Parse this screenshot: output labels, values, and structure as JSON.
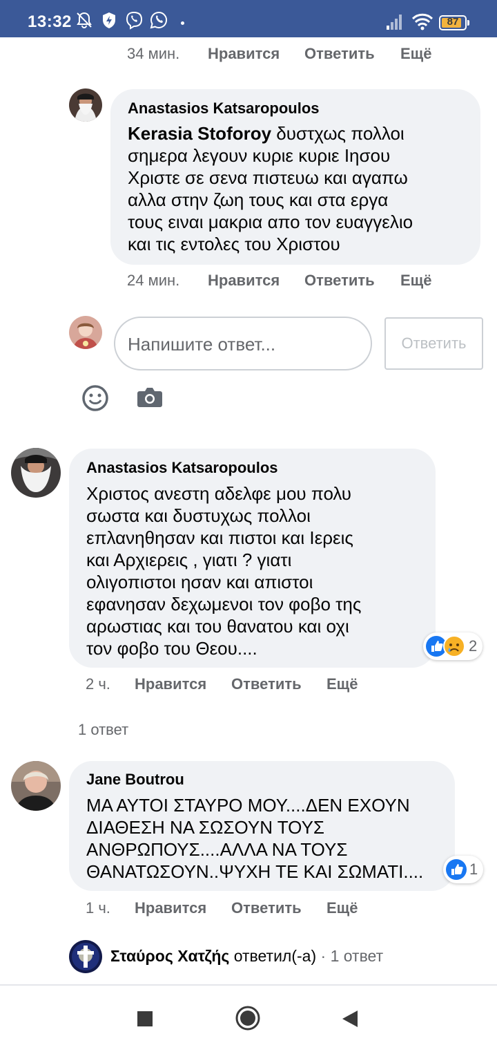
{
  "status_bar": {
    "time": "13:32",
    "battery": "87",
    "battery_level": 0.87,
    "icons": [
      "bell-off-icon",
      "shield-icon",
      "viber-icon",
      "whatsapp-icon",
      "signal-icon",
      "wifi-icon",
      "battery-icon"
    ]
  },
  "top_actions": {
    "time": "34 мин.",
    "like": "Нравится",
    "reply": "Ответить",
    "more": "Ещё"
  },
  "reply_comment": {
    "author": "Anastasios Katsaropoulos",
    "mention": "Kerasia Stoforoy",
    "lines": [
      " δυστχως πολλοι",
      "σημερα λεγουν κυριε κυριε Ιησου",
      "Χριστε σε σενα πιστευω και αγαπω",
      "αλλα στην ζωη τους και στα εργα",
      "τους ειναι μακρια απο τον ευαγγελιο",
      "και τις εντολες του Χριστου"
    ],
    "actions": {
      "time": "24 мин.",
      "like": "Нравится",
      "reply": "Ответить",
      "more": "Ещё"
    }
  },
  "composer": {
    "placeholder": "Напишите ответ...",
    "button": "Ответить",
    "icons": [
      "emoji-icon",
      "camera-icon"
    ]
  },
  "comment_1": {
    "author": "Anastasios Katsaropoulos",
    "lines": [
      "Χριστος ανεστη αδελφε μου πολυ",
      "σωστα και δυστυχως πολλοι",
      "επλανηθησαν και πιστοι και Ιερεις",
      "και Αρχιερεις , γιατι ? γιατι",
      "ολιγοπιστοι ησαν και απιστοι",
      "εφανησαν δεχωμενοι τον φοβο της",
      "αρωστιας και του θανατου και οχι",
      "τον φοβο του Θεου...."
    ],
    "reactions": {
      "count": "2",
      "icons": [
        "like-reaction-icon",
        "sad-reaction-icon"
      ]
    },
    "actions": {
      "time": "2 ч.",
      "like": "Нравится",
      "reply": "Ответить",
      "more": "Ещё"
    },
    "replies_link": "1 ответ"
  },
  "comment_2": {
    "author": "Jane Boutrou",
    "lines": [
      "ΜΑ ΑΥΤΟΙ ΣΤΑΥΡΟ ΜΟΥ....ΔΕΝ ΕΧΟΥΝ",
      "ΔΙΑΘΕΣΗ ΝΑ ΣΩΣΟΥΝ ΤΟΥΣ",
      "ΑΝΘΡΩΠΟΥΣ....ΑΛΛΑ ΝΑ ΤΟΥΣ",
      "ΘΑΝΑΤΩΣΟΥΝ..ΨΥΧΗ ΤΕ ΚΑΙ ΣΩΜΑΤΙ...."
    ],
    "reactions": {
      "count": "1",
      "icons": [
        "like-reaction-icon"
      ]
    },
    "actions": {
      "time": "1 ч.",
      "like": "Нравится",
      "reply": "Ответить",
      "more": "Ещё"
    }
  },
  "reply_preview": {
    "author": "Σταύρος Χατζής",
    "action": "ответил(-а)",
    "separator": "·",
    "count": "1 ответ"
  },
  "nav": {
    "icons": [
      "recents-square-icon",
      "home-circle-icon",
      "back-triangle-icon"
    ]
  },
  "colors": {
    "status_bar": "#3b5998",
    "bubble": "#f0f2f5",
    "secondary_text": "#65676b",
    "like_blue": "#1877f2"
  }
}
